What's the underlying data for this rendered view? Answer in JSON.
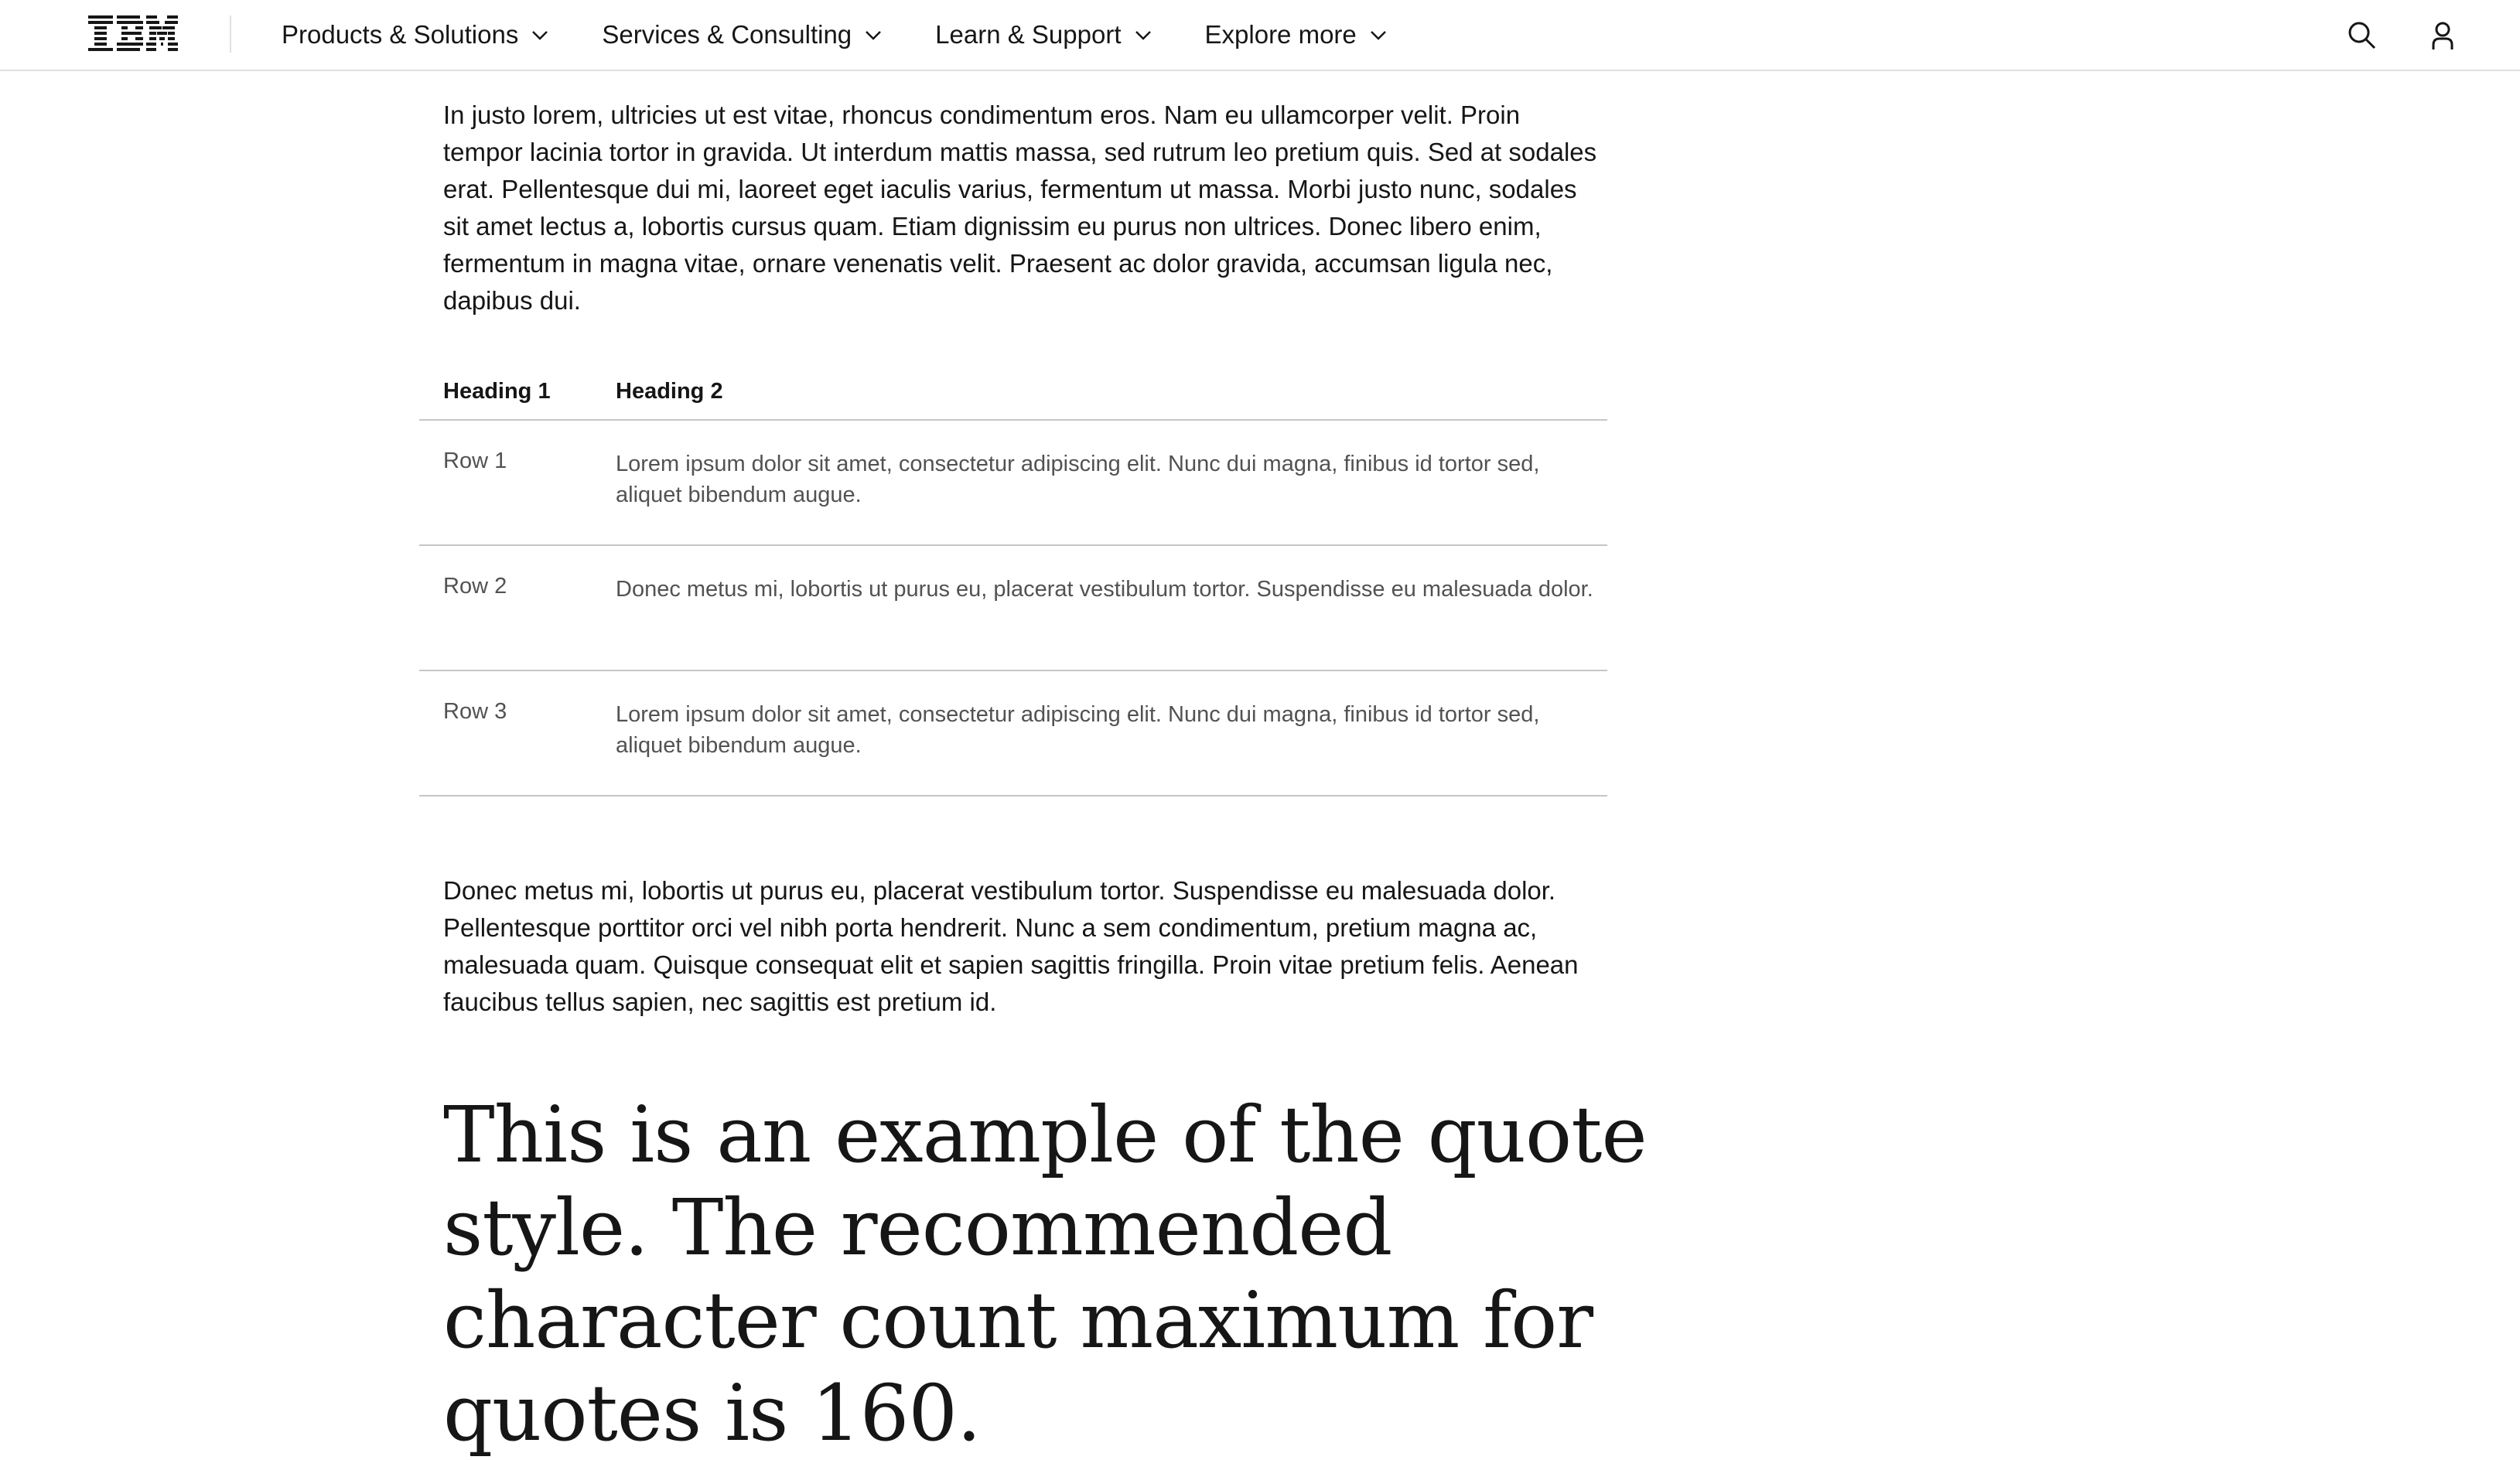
{
  "header": {
    "logo_text": "IBM",
    "nav": [
      {
        "label": "Products & Solutions"
      },
      {
        "label": "Services & Consulting"
      },
      {
        "label": "Learn & Support"
      },
      {
        "label": "Explore more"
      }
    ],
    "actions": {
      "search_icon": "search-icon",
      "user_icon": "user-icon"
    }
  },
  "main": {
    "paragraph_1": "In justo lorem, ultricies ut est vitae, rhoncus condimentum eros. Nam eu ullamcorper velit. Proin tempor lacinia tortor in gravida. Ut interdum mattis massa, sed rutrum leo pretium quis. Sed at sodales erat. Pellentesque dui mi, laoreet eget iaculis varius, fermentum ut massa. Morbi justo nunc, sodales sit amet lectus a, lobortis cursus quam. Etiam dignissim eu purus non ultrices. Donec libero enim, fermentum in magna vitae, ornare venenatis velit. Praesent ac dolor gravida, accumsan ligula nec, dapibus dui.",
    "table": {
      "headers": [
        "Heading 1",
        "Heading 2"
      ],
      "rows": [
        [
          "Row 1",
          "Lorem ipsum dolor sit amet, consectetur adipiscing elit. Nunc dui magna, finibus id tortor sed, aliquet bibendum augue."
        ],
        [
          "Row 2",
          "Donec metus mi, lobortis ut purus eu, placerat vestibulum tortor. Suspendisse eu malesuada dolor."
        ],
        [
          "Row 3",
          "Lorem ipsum dolor sit amet, consectetur adipiscing elit. Nunc dui magna, finibus id tortor sed, aliquet bibendum augue."
        ]
      ]
    },
    "paragraph_2": "Donec metus mi, lobortis ut purus eu, placerat vestibulum tortor. Suspendisse eu malesuada dolor. Pellentesque porttitor orci vel nibh porta hendrerit. Nunc a sem condimentum, pretium magna ac, malesuada quam. Quisque consequat elit et sapien sagittis fringilla. Proin vitae pretium felis. Aenean faucibus tellus sapien, nec sagittis est pretium id.",
    "quote": "This is an example of the quote style. The recommended character count maximum for quotes is 160."
  },
  "colors": {
    "text_primary": "#161616",
    "text_secondary": "#525252",
    "border": "#c6c6c6",
    "header_border": "#e0e0e0"
  }
}
